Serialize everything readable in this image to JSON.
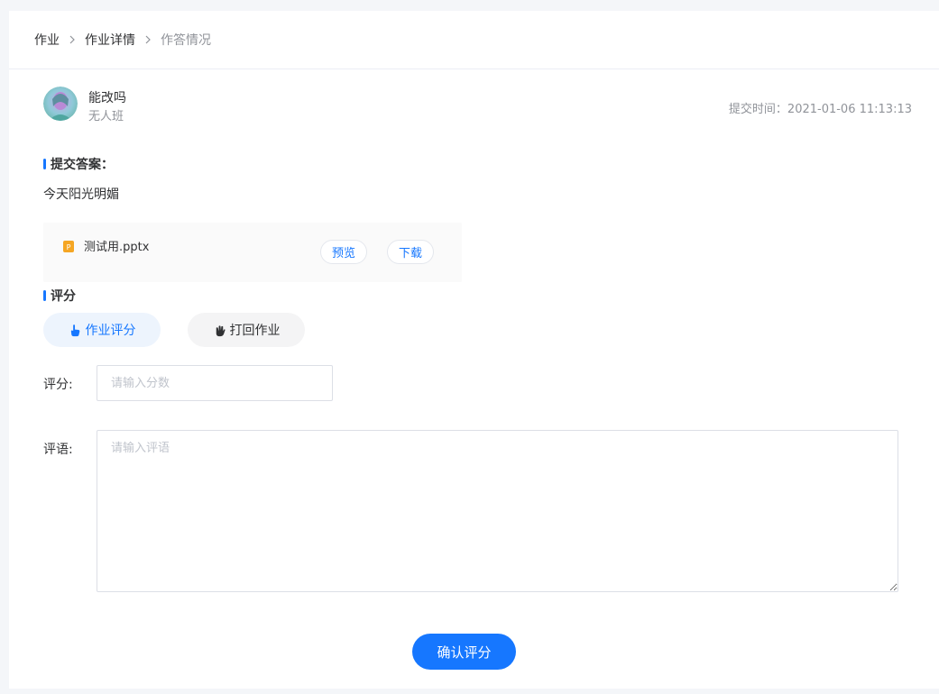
{
  "breadcrumb": {
    "items": [
      "作业",
      "作业详情",
      "作答情况"
    ]
  },
  "student": {
    "name": "能改吗",
    "class_name": "无人班",
    "submit_time": "提交时间：2021-01-06 11:13:13"
  },
  "answer": {
    "section_title": "提交答案：",
    "text": "今天阳光明媚",
    "attachment": {
      "file_name": "测试用.pptx",
      "icon": "ppt-file-icon",
      "preview_label": "预览",
      "download_label": "下载"
    }
  },
  "grading": {
    "section_title": "评分",
    "tabs": [
      {
        "label": "作业评分",
        "icon": "pointing-hand-icon",
        "active": true
      },
      {
        "label": "打回作业",
        "icon": "waving-hand-icon",
        "active": false
      }
    ],
    "score_label": "评分:",
    "score_placeholder": "请输入分数",
    "comment_label": "评语:",
    "comment_placeholder": "请输入评语",
    "confirm_label": "确认评分"
  },
  "colors": {
    "accent": "#1677ff",
    "page_bg": "#f4f6f9",
    "muted_text": "#909399"
  }
}
